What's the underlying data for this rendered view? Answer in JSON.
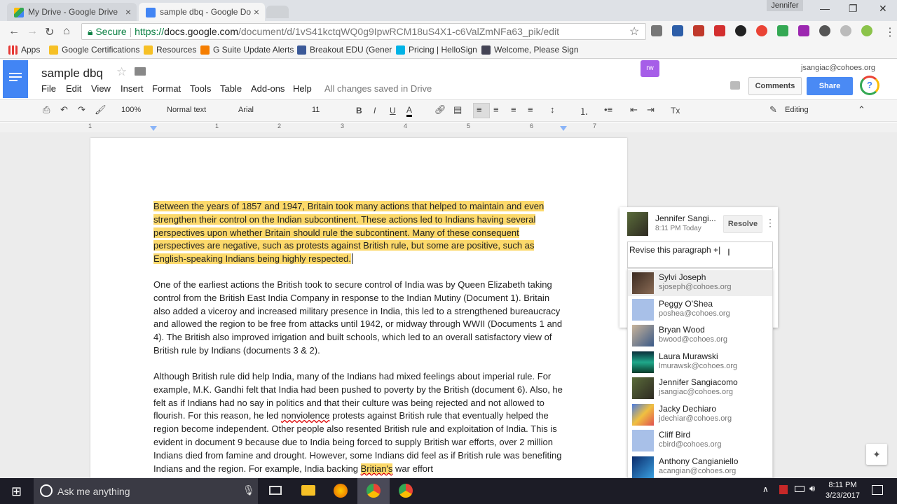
{
  "browser": {
    "tabs": [
      {
        "label": "My Drive - Google Drive",
        "close": "×"
      },
      {
        "label": "sample dbq - Google Do",
        "close": "×"
      }
    ],
    "user": "Jennifer",
    "address": {
      "secure_label": "Secure",
      "url_prefix": "https://",
      "url_domain": "docs.google.com",
      "url_path": "/document/d/1vS41kctqWQ0g9IpwRCM18uS4X1-c6ValZmNFa63_pik/edit"
    },
    "bookmarks": [
      "Apps",
      "Google Certifications",
      "Resources",
      "G Suite Update Alerts",
      "Breakout EDU (Gener",
      "Pricing | HelloSign",
      "Welcome, Please Sign"
    ]
  },
  "docs": {
    "title": "sample dbq",
    "menus": [
      "File",
      "Edit",
      "View",
      "Insert",
      "Format",
      "Tools",
      "Table",
      "Add-ons",
      "Help"
    ],
    "saved_status": "All changes saved in Drive",
    "account": "jsangiac@cohoes.org",
    "comments_label": "Comments",
    "share_label": "Share",
    "addon_label": "rw",
    "toolbar": {
      "zoom": "100%",
      "style": "Normal text",
      "font": "Arial",
      "size": "11",
      "bold": "B",
      "italic": "I",
      "underline": "U",
      "text_color": "A",
      "mode": "Editing",
      "clear_format": "Tx"
    },
    "ruler": [
      "1",
      "1",
      "2",
      "3",
      "4",
      "5",
      "6",
      "7"
    ]
  },
  "document": {
    "p1": "Between the years of 1857 and 1947, Britain took many actions that helped to maintain and even strengthen their control on the Indian subcontinent. These actions led to Indians having several perspectives upon whether Britain should rule the subcontinent. Many of these consequent perspectives are negative, such as protests against British rule, but some are positive, such as English-speaking Indians being highly respected.",
    "p2": "One of the earliest actions the British took to secure control of India was by Queen Elizabeth taking control from the British East India Company in response to the Indian Mutiny (Document 1). Britain also added a viceroy and increased military presence in India, this led to a strengthened bureaucracy and allowed the region to be free from attacks until 1942, or midway through WWII (Documents 1 and 4). The British also improved irrigation and built schools, which led to an overall satisfactory view of British rule by Indians (documents 3 & 2).",
    "p3_a": "Although British rule did help India, many of the Indians had mixed feelings about imperial rule. For example, M.K. Gandhi felt that India had been pushed to poverty by the British (document 6). Also, he felt as if Indians had no say in politics and that their culture was being rejected and not allowed to flourish. For this reason, he led ",
    "p3_b": "nonviolence",
    "p3_c": " protests against British rule that eventually helped the region become independent. Other people also resented British rule and exploitation of India. This is evident in document 9 because due to India being forced to supply British war efforts, over 2 million Indians died from famine and drought. However, some Indians did feel as if British rule was benefiting Indians and the region. For example, India backing ",
    "p3_d": "Britian's",
    "p3_e": " war effort"
  },
  "comment": {
    "author": "Jennifer Sangi...",
    "time": "8:11 PM Today",
    "resolve_label": "Resolve",
    "draft": "Revise this paragraph +|",
    "people": [
      {
        "name": "Sylvi Joseph",
        "email": "sjoseph@cohoes.org"
      },
      {
        "name": "Peggy O'Shea",
        "email": "poshea@cohoes.org"
      },
      {
        "name": "Bryan Wood",
        "email": "bwood@cohoes.org"
      },
      {
        "name": "Laura Murawski",
        "email": "lmurawsk@cohoes.org"
      },
      {
        "name": "Jennifer Sangiacomo",
        "email": "jsangiac@cohoes.org"
      },
      {
        "name": "Jacky Dechiaro",
        "email": "jdechiar@cohoes.org"
      },
      {
        "name": "Cliff Bird",
        "email": "cbird@cohoes.org"
      },
      {
        "name": "Anthony Cangianiello",
        "email": "acangian@cohoes.org"
      }
    ]
  },
  "taskbar": {
    "search_placeholder": "Ask me anything",
    "time": "8:11 PM",
    "date": "3/23/2017"
  }
}
